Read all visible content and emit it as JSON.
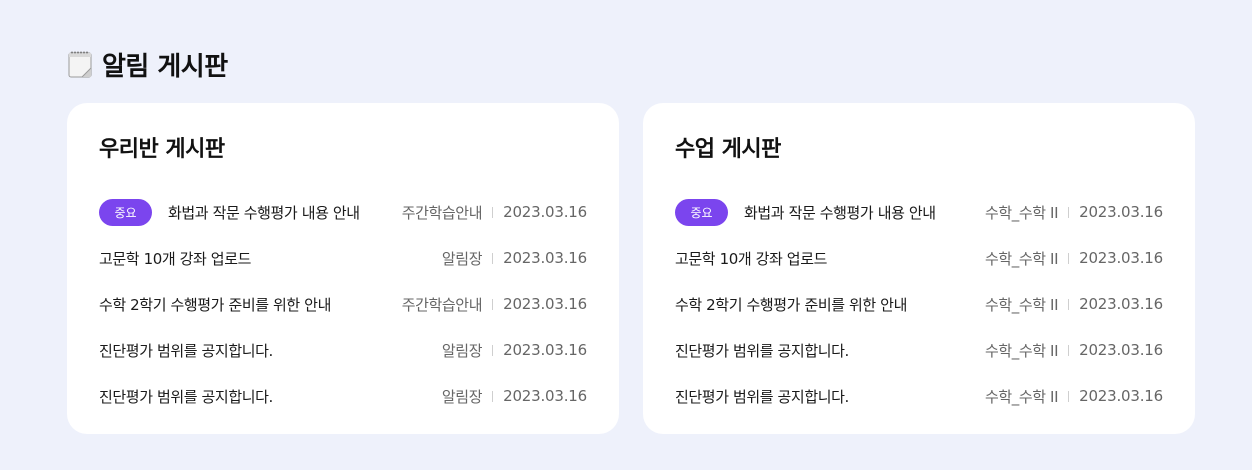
{
  "header": {
    "icon": "notepad-icon",
    "title": "알림 게시판"
  },
  "colors": {
    "background": "#eef1fb",
    "card": "#ffffff",
    "badge": "#7b45ee"
  },
  "boards": [
    {
      "title": "우리반 게시판",
      "posts": [
        {
          "badge": "중요",
          "title": "화법과 작문 수행평가 내용 안내",
          "category": "주간학습안내",
          "date": "2023.03.16"
        },
        {
          "badge": null,
          "title": "고문학 10개 강좌 업로드",
          "category": "알림장",
          "date": "2023.03.16"
        },
        {
          "badge": null,
          "title": "수학 2학기 수행평가 준비를 위한 안내",
          "category": "주간학습안내",
          "date": "2023.03.16"
        },
        {
          "badge": null,
          "title": "진단평가 범위를 공지합니다.",
          "category": "알림장",
          "date": "2023.03.16"
        },
        {
          "badge": null,
          "title": "진단평가 범위를 공지합니다.",
          "category": "알림장",
          "date": "2023.03.16"
        }
      ]
    },
    {
      "title": "수업 게시판",
      "posts": [
        {
          "badge": "중요",
          "title": "화법과 작문 수행평가 내용 안내",
          "category": "수학_수학 II",
          "date": "2023.03.16"
        },
        {
          "badge": null,
          "title": "고문학 10개 강좌 업로드",
          "category": "수학_수학 II",
          "date": "2023.03.16"
        },
        {
          "badge": null,
          "title": "수학 2학기 수행평가 준비를 위한 안내",
          "category": "수학_수학 II",
          "date": "2023.03.16"
        },
        {
          "badge": null,
          "title": "진단평가 범위를 공지합니다.",
          "category": "수학_수학 II",
          "date": "2023.03.16"
        },
        {
          "badge": null,
          "title": "진단평가 범위를 공지합니다.",
          "category": "수학_수학 II",
          "date": "2023.03.16"
        }
      ]
    }
  ]
}
